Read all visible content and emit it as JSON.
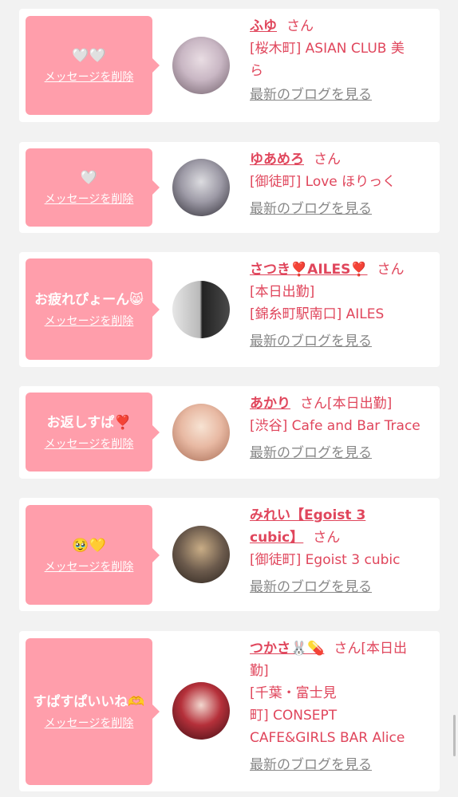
{
  "cards": [
    {
      "message": "🤍🤍",
      "delete_label": "メッセージを削除",
      "name": "ふゆ",
      "san": "さん",
      "lines": [
        "[桜木町] ASIAN CLUB 美",
        "ら"
      ],
      "blog": "最新のブログを見る",
      "avatar_color": "#c9b7c4"
    },
    {
      "message": "🤍",
      "delete_label": "メッセージを削除",
      "name": "ゆあめろ",
      "san": "さん",
      "lines": [
        "[御徒町] Love ほりっく"
      ],
      "blog": "最新のブログを見る",
      "avatar_color": "#9d9aa6"
    },
    {
      "message": "お疲れぴょーん😸",
      "delete_label": "メッセージを削除",
      "name": "さつき❣️AILES❣️",
      "san": "さん",
      "lines": [
        "[本日出勤]",
        "[錦糸町駅南口] AILES"
      ],
      "blog": "最新のブログを見る",
      "avatar_color": "#4a4a4a"
    },
    {
      "message": "お返しすぱ❣️",
      "delete_label": "メッセージを削除",
      "name": "あかり",
      "san": "さん[本日出勤]",
      "lines": [
        "[渋谷] Cafe and Bar Trace"
      ],
      "blog": "最新のブログを見る",
      "avatar_color": "#e8b9a3"
    },
    {
      "message": "🥹💛",
      "delete_label": "メッセージを削除",
      "name": "みれい【Egoist 3 cubic】",
      "san": "さん",
      "lines": [
        "[御徒町] Egoist 3 cubic"
      ],
      "blog": "最新のブログを見る",
      "avatar_color": "#6b5a4c"
    },
    {
      "message": "すぱすぱいいね🫶",
      "delete_label": "メッセージを削除",
      "name": "つかさ🐰💊",
      "san": "さん[本日出",
      "lines": [
        "勤]",
        "[千葉・富士見",
        "町] CONSEPT",
        "CAFE&GIRLS BAR Alice"
      ],
      "blog": "最新のブログを見る",
      "avatar_color": "#b5303a"
    }
  ]
}
